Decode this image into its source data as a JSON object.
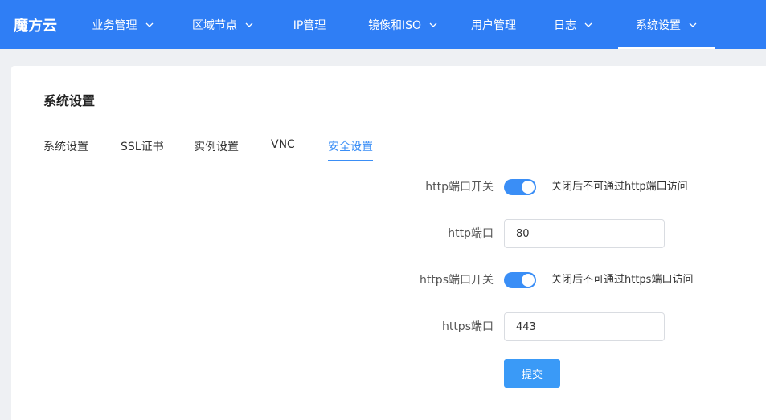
{
  "brand": "魔方云",
  "nav": [
    {
      "label": "业务管理",
      "dropdown": true
    },
    {
      "label": "区域节点",
      "dropdown": true
    },
    {
      "label": "IP管理",
      "dropdown": false
    },
    {
      "label": "镜像和ISO",
      "dropdown": true
    },
    {
      "label": "用户管理",
      "dropdown": false
    },
    {
      "label": "日志",
      "dropdown": true
    },
    {
      "label": "系统设置",
      "dropdown": true,
      "active": true
    }
  ],
  "page": {
    "title": "系统设置",
    "tabs": [
      "系统设置",
      "SSL证书",
      "实例设置",
      "VNC",
      "安全设置"
    ],
    "active_tab": "安全设置"
  },
  "form": {
    "http_switch_label": "http端口开关",
    "http_switch_on": true,
    "http_switch_hint": "关闭后不可通过http端口访问",
    "http_port_label": "http端口",
    "http_port_value": "80",
    "https_switch_label": "https端口开关",
    "https_switch_on": true,
    "https_switch_hint": "关闭后不可通过https端口访问",
    "https_port_label": "https端口",
    "https_port_value": "443",
    "submit_label": "提交"
  },
  "colors": {
    "nav_bg": "#2f7ef5",
    "accent": "#3a8ef6"
  }
}
